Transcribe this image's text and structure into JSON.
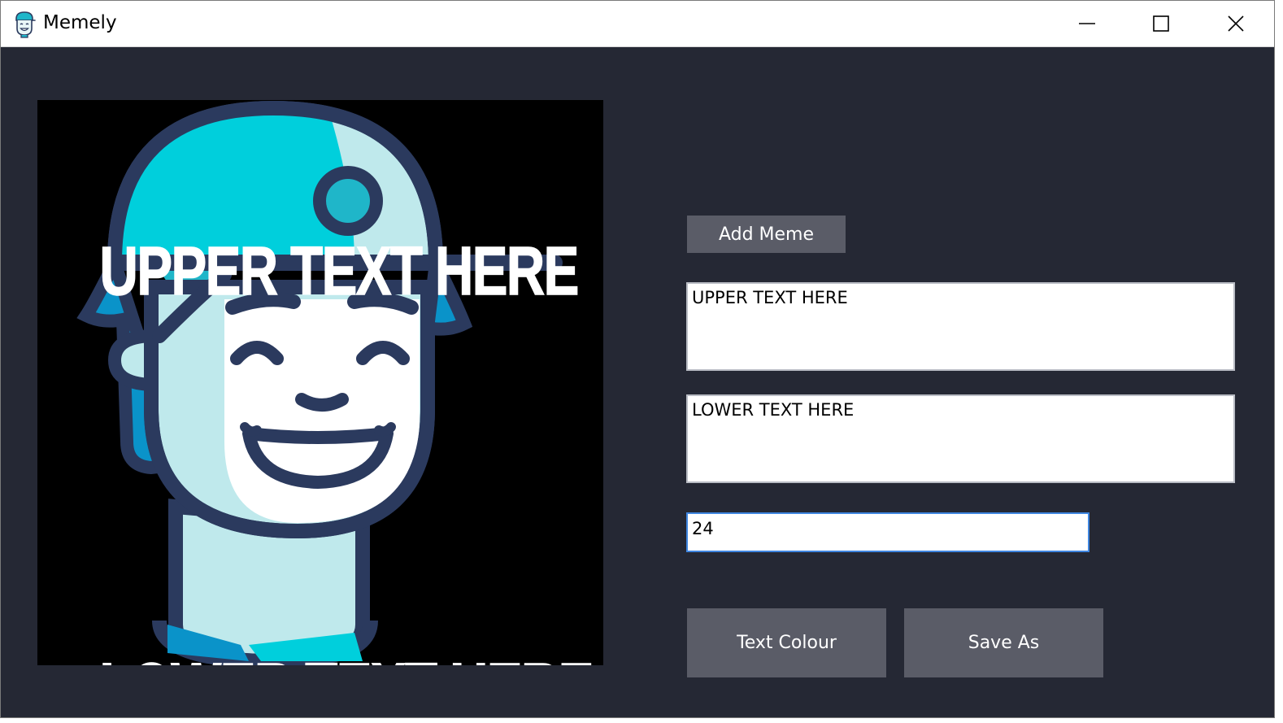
{
  "window": {
    "title": "Memely",
    "icon": "memely-logo-icon",
    "controls": {
      "minimize": "minimize-icon",
      "maximize": "maximize-icon",
      "close": "close-icon"
    }
  },
  "meme": {
    "upper_text": "UPPER TEXT HERE",
    "lower_text": "LOWER TEXT HERE",
    "image": "cartoon boy with cap"
  },
  "controls": {
    "add_meme_label": "Add Meme",
    "upper_text_value": "UPPER TEXT HERE",
    "lower_text_value": "LOWER TEXT HERE",
    "font_size_value": "24",
    "text_colour_label": "Text Colour",
    "save_as_label": "Save As"
  },
  "colors": {
    "background": "#252834",
    "button": "#5a5c67",
    "accent_focus": "#3f86e0",
    "meme_text": "#ffffff"
  }
}
